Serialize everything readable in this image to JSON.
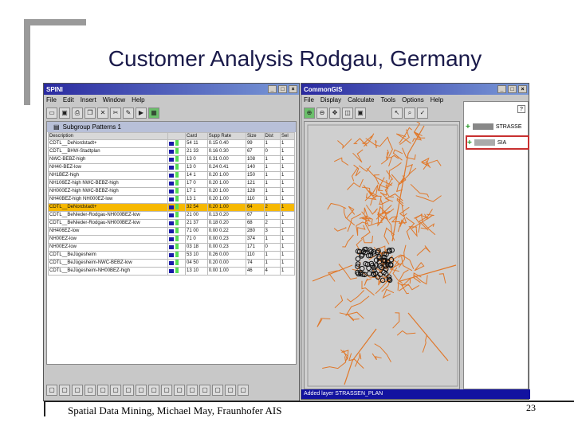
{
  "slide": {
    "title": "Customer Analysis Rodgau, Germany",
    "footer": "Spatial Data Mining, Michael May, Fraunhofer AIS",
    "page_number": "23"
  },
  "spini": {
    "title": "SPINI",
    "menu": [
      "File",
      "Edit",
      "Insert",
      "Window",
      "Help"
    ],
    "panel_title": "Subgroup Patterns 1",
    "columns": [
      "Description",
      "Card",
      "Supp Rate",
      "Size",
      "Dist",
      "Sel"
    ],
    "rows": [
      [
        "CDTL__DeNordstadt+",
        "54 11",
        "0.15 0.40",
        "99",
        "1",
        "1"
      ],
      [
        "CDTL__BHW-Stadtplan",
        "21 33",
        "0.16 0.30",
        "67",
        "0",
        "1"
      ],
      [
        "NWC-BEBZ-high",
        "13 0",
        "0.31 0.00",
        "108",
        "1",
        "1"
      ],
      [
        "NH40-BEZ-low",
        "13 0",
        "0.24 0.41",
        "140",
        "1",
        "1"
      ],
      [
        "NH1BEZ-high",
        "14 1",
        "0.20 1.00",
        "150",
        "1",
        "1"
      ],
      [
        "NH106EZ-high NWC-BEBZ-high",
        "17 0",
        "0.20 1.00",
        "121",
        "1",
        "1"
      ],
      [
        "NH000EZ-high NWC-BEBZ-high",
        "17 1",
        "0.20 1.00",
        "128",
        "1",
        "1"
      ],
      [
        "NH40BEZ-high NH000EZ-low",
        "13 1",
        "0.20 1.00",
        "110",
        "1",
        "1"
      ],
      [
        "CDTL__DeNordstadt+",
        "32 54",
        "0.20 1.00",
        "64",
        "2",
        "1"
      ],
      [
        "CDTL__BeNieder-Rodgau-NH000BEZ-low",
        "21 00",
        "0.13 0.20",
        "67",
        "1",
        "1"
      ],
      [
        "CDTL__BeNieder-Rodgau-NH000BEZ-low",
        "21 37",
        "0.18 0.20",
        "68",
        "2",
        "1"
      ],
      [
        "NH406EZ-low",
        "71 00",
        "0.00 0.22",
        "280",
        "3",
        "1"
      ],
      [
        "NH00EZ-low",
        "71 0",
        "0.00 0.23",
        "374",
        "1",
        "1"
      ],
      [
        "NH00EZ-low",
        "03 18",
        "0.00 0.23",
        "171",
        "0",
        "1"
      ],
      [
        "CDTL__BeJügesheim",
        "53 10",
        "0.26 0.00",
        "110",
        "1",
        "1"
      ],
      [
        "CDTL__BeJügesheim-NWC-BEBZ-low",
        "04 50",
        "0.20 0.00",
        "74",
        "1",
        "1"
      ],
      [
        "CDTL__BeJügesheim-NH00BEZ-high",
        "13 10",
        "0.00 1.00",
        "46",
        "4",
        "1"
      ]
    ],
    "highlight_row": 8
  },
  "cgis": {
    "title": "CommonGIS",
    "menu": [
      "File",
      "Display",
      "Calculate",
      "Tools",
      "Options",
      "Help"
    ],
    "help_btn": "?",
    "legend": [
      {
        "label": "STRASSE"
      },
      {
        "label": "SIA"
      }
    ],
    "status": "Added layer STRASSEN_PLAN"
  },
  "colors": {
    "road": "#e0782a",
    "customer": "#111111",
    "highlight": "#f6b800"
  }
}
